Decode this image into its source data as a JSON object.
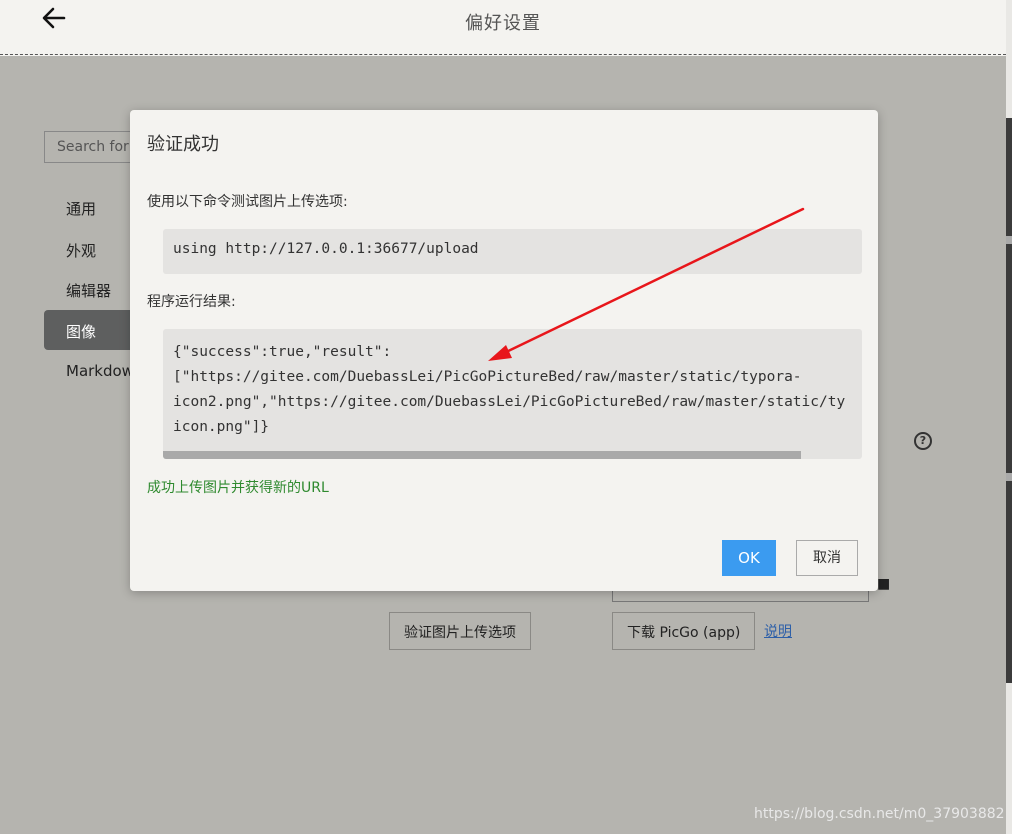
{
  "window": {
    "title": "偏好设置"
  },
  "sidebar": {
    "search_placeholder": "Search for",
    "items": [
      {
        "label": "通用",
        "active": false
      },
      {
        "label": "外观",
        "active": false
      },
      {
        "label": "编辑器",
        "active": false
      },
      {
        "label": "图像",
        "active": true
      },
      {
        "label": "Markdown",
        "active": false
      }
    ]
  },
  "background": {
    "validate_button": "验证图片上传选项",
    "download_button": "下载 PicGo (app)",
    "help_link": "说明"
  },
  "dialog": {
    "title": "验证成功",
    "command_label": "使用以下命令测试图片上传选项:",
    "command": "using http://127.0.0.1:36677/upload",
    "result_label": "程序运行结果:",
    "result_lines": [
      "{\"success\":true,\"result\":",
      "[\"https://gitee.com/DuebassLei/PicGoPictureBed/raw/master/static/typora-",
      "icon2.png\",\"https://gitee.com/DuebassLei/PicGoPictureBed/raw/master/static/ty",
      "icon.png\"]}"
    ],
    "success_message": "成功上传图片并获得新的URL",
    "ok_label": "OK",
    "cancel_label": "取消"
  },
  "colors": {
    "accent": "#3b9bf0",
    "success": "#2f8a2f",
    "annotation": "#e8161b"
  },
  "watermark": "https://blog.csdn.net/m0_37903882"
}
